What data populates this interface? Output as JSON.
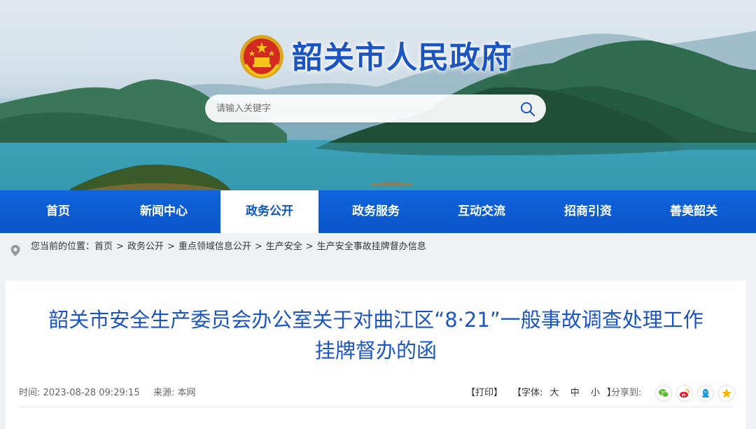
{
  "site": {
    "title": "韶关市人民政府"
  },
  "search": {
    "placeholder": "请输入关键字"
  },
  "nav": {
    "items": [
      {
        "label": "首页"
      },
      {
        "label": "新闻中心"
      },
      {
        "label": "政务公开",
        "active": true
      },
      {
        "label": "政务服务"
      },
      {
        "label": "互动交流"
      },
      {
        "label": "招商引资"
      },
      {
        "label": "善美韶关"
      }
    ]
  },
  "breadcrumb": {
    "prefix": "您当前的位置：",
    "items": [
      "首页",
      "政务公开",
      "重点领域信息公开",
      "生产安全",
      "生产安全事故挂牌督办信息"
    ],
    "separator": ">"
  },
  "article": {
    "title_line1": "韶关市安全生产委员会办公室关于对曲江区“8·21”一般事故调查处理工作",
    "title_line2": "挂牌督办的函",
    "time_label": "时间:",
    "time": "2023-08-28 09:29:15",
    "source_label": "来源:",
    "source": "本网",
    "print_label": "【打印】",
    "font_label": "【字体:",
    "font_large": "大",
    "font_medium": "中",
    "font_small": "小",
    "font_close": "】",
    "share_label": "分享到:"
  },
  "share_icons": [
    "wechat-icon",
    "weibo-icon",
    "qq-icon",
    "qzone-icon"
  ],
  "colors": {
    "brand_blue": "#0a55c8",
    "title_blue": "#1c54c0",
    "wechat_green": "#5ab92d",
    "weibo_red": "#e6162d",
    "qq_blue": "#1a9bdb",
    "qzone_yellow": "#f4b400"
  }
}
